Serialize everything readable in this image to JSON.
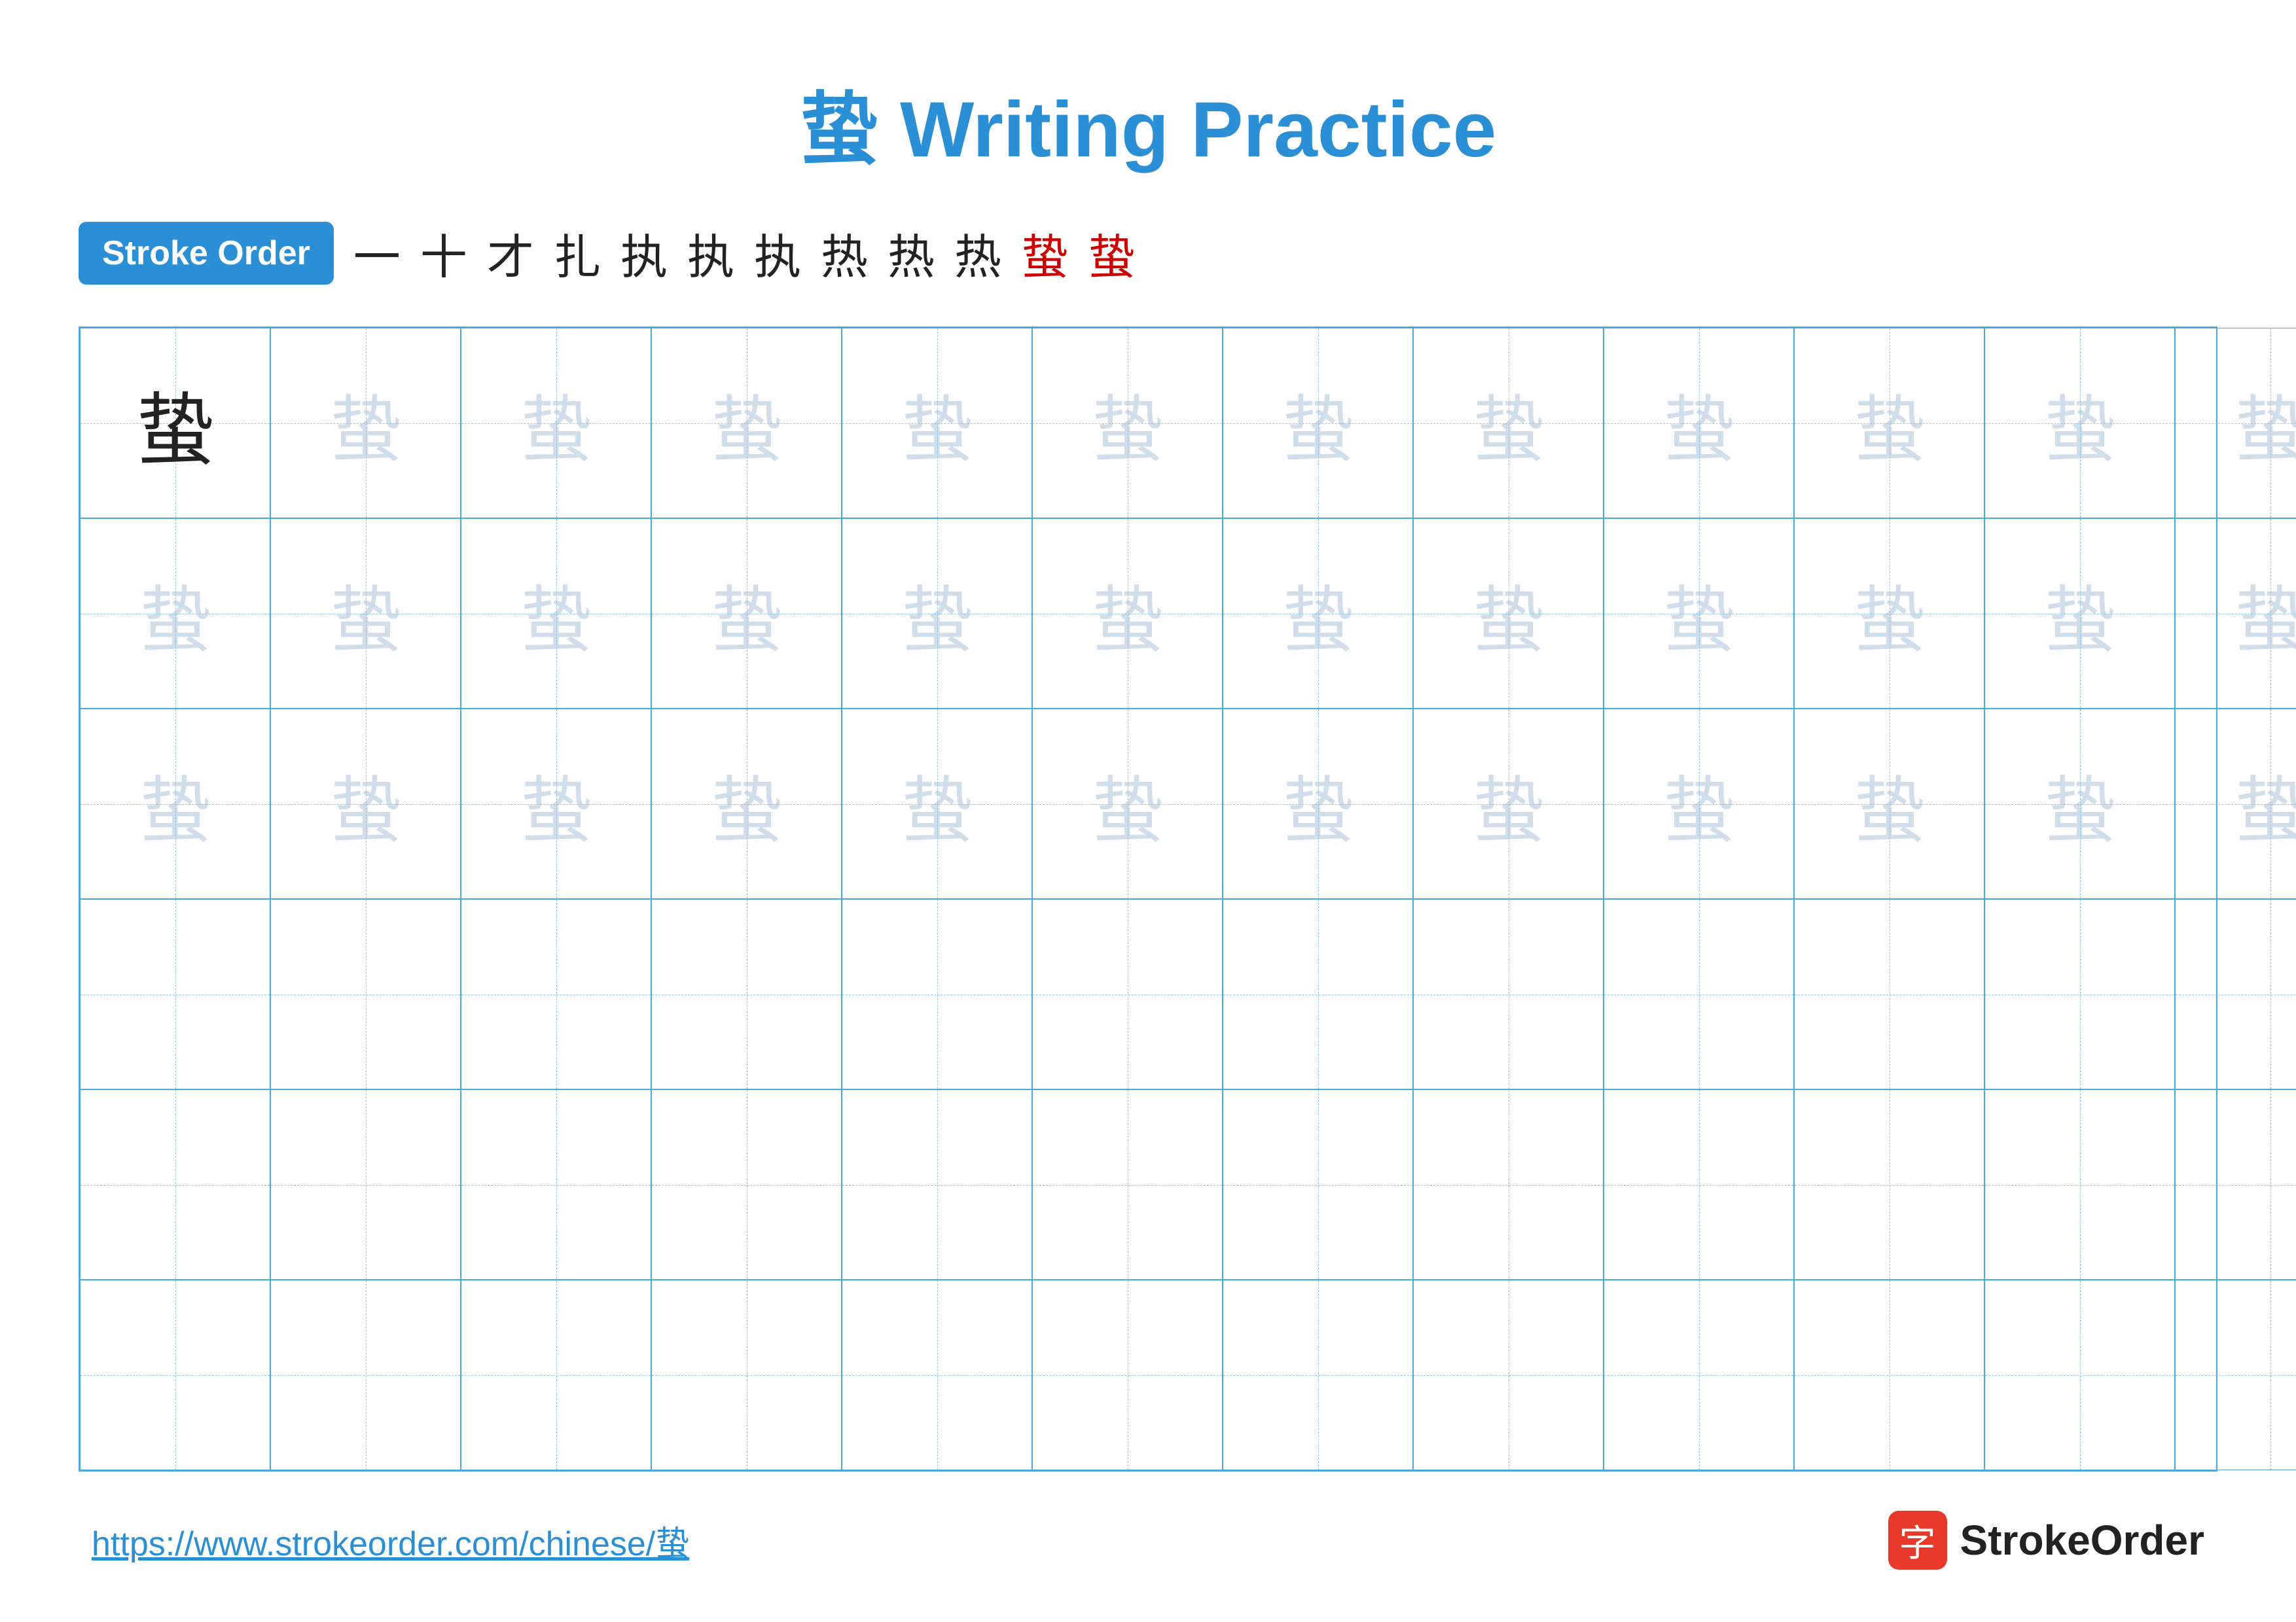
{
  "title": "蛰 Writing Practice",
  "stroke_order": {
    "label": "Stroke Order",
    "steps": [
      "一",
      "十",
      "才",
      "扎",
      "执",
      "执",
      "执",
      "热",
      "热",
      "热",
      "蛰",
      "蛰"
    ]
  },
  "main_char": "蛰",
  "grid": {
    "rows": 6,
    "cols": 13
  },
  "footer": {
    "url": "https://www.strokeorder.com/chinese/蛰",
    "brand_char": "字",
    "brand_name": "StrokeOrder"
  }
}
